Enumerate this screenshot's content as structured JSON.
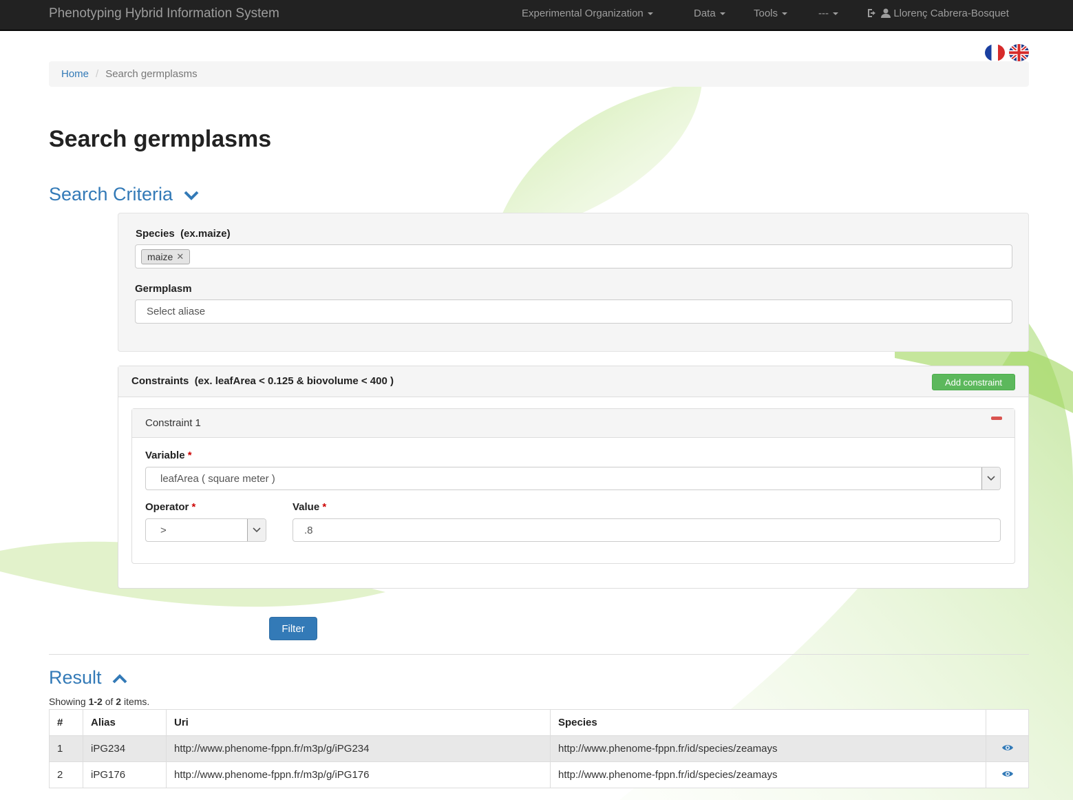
{
  "navbar": {
    "brand": "Phenotyping Hybrid Information System",
    "menus": [
      "Experimental Organization",
      "Data",
      "Tools",
      "---"
    ],
    "user": "Llorenç Cabrera-Bosquet"
  },
  "breadcrumb": {
    "home": "Home",
    "current": "Search germplasms"
  },
  "page_title": "Search germplasms",
  "search_criteria": {
    "title": "Search Criteria",
    "species_label": "Species",
    "species_hint": "(ex.maize)",
    "species_tag": "maize",
    "germplasm_label": "Germplasm",
    "germplasm_placeholder": "Select aliase"
  },
  "constraints": {
    "title": "Constraints",
    "hint": "(ex. leafArea < 0.125 & biovolume < 400 )",
    "add_label": "Add constraint",
    "items": [
      {
        "title": "Constraint 1",
        "variable_label": "Variable",
        "variable_value": "leafArea ( square meter )",
        "operator_label": "Operator",
        "operator_value": ">",
        "value_label": "Value",
        "value_value": ".8",
        "required_mark": "*"
      }
    ]
  },
  "filter_label": "Filter",
  "result": {
    "title": "Result",
    "summary_prefix": "Showing",
    "summary_range": "1-2",
    "summary_of": "of",
    "summary_total": "2",
    "summary_suffix": "items.",
    "headers": [
      "#",
      "Alias",
      "Uri",
      "Species",
      ""
    ],
    "rows": [
      {
        "n": "1",
        "alias": "iPG234",
        "uri": "http://www.phenome-fppn.fr/m3p/g/iPG234",
        "species": "http://www.phenome-fppn.fr/id/species/zeamays"
      },
      {
        "n": "2",
        "alias": "iPG176",
        "uri": "http://www.phenome-fppn.fr/m3p/g/iPG176",
        "species": "http://www.phenome-fppn.fr/id/species/zeamays"
      }
    ]
  },
  "colors": {
    "link": "#337ab7",
    "success": "#5cb85c",
    "danger": "#d9534f",
    "navbar": "#222222"
  }
}
